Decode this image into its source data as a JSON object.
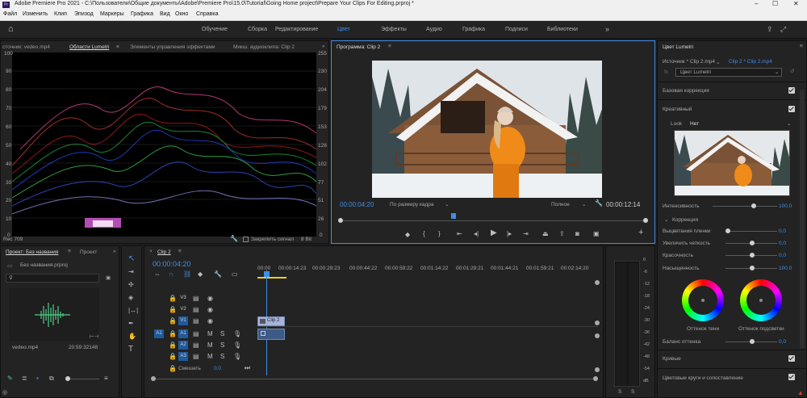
{
  "titlebar": {
    "title": "Adobe Premiere Pro 2021 - C:\\Пользователи\\Общие документы\\Adobe\\Premiere Pro\\15.0\\Tutorial\\Going Home project\\Prepare Your Clips For Editing.prproj *"
  },
  "menu": [
    "Файл",
    "Изменить",
    "Клип",
    "Эпизод",
    "Маркеры",
    "Графика",
    "Вид",
    "Окно",
    "Справка"
  ],
  "workspaces": [
    "Обучение",
    "Сборка",
    "Редактирование",
    "Цвет",
    "Эффекты",
    "Аудио",
    "Графика",
    "Подписи",
    "Библиотеки"
  ],
  "active_workspace": "Цвет",
  "source_panel": {
    "tabs": [
      "сточник: vedeo.mp4",
      "Области Lumetri",
      "Элементы управления эффектами",
      "Микш. аудиоклипа: Clip 2"
    ],
    "left_scale": [
      "100",
      "90",
      "80",
      "70",
      "60",
      "50",
      "40",
      "30",
      "20",
      "10",
      "0"
    ],
    "right_scale": [
      "255",
      "230",
      "204",
      "179",
      "153",
      "128",
      "102",
      "77",
      "51",
      "26",
      "0"
    ],
    "footer_left": "Rec 709",
    "footer_clamp": "Закрепить сигнал",
    "footer_bit": "8 Bit"
  },
  "program_monitor": {
    "title": "Программа: Clip 2",
    "timecode_left": "00:00:04:20",
    "fit": "По размеру кадра",
    "quality": "Полное",
    "timecode_right": "00:00:12:14"
  },
  "project_panel": {
    "tabs": [
      "Проект: Без названия",
      "Проект"
    ],
    "project_file": "Без названия.prproj",
    "clip_name": "vedeo.mp4",
    "clip_duration": "20:59:32148"
  },
  "timeline": {
    "tab": "Clip 2",
    "timecode": "00:00:04:20",
    "ruler": [
      "00:00",
      "00:00:14:23",
      "00:00:29:23",
      "00:00:44:22",
      "00:00:59:22",
      "00:01:14:22",
      "00:01:29:21",
      "00:01:44:21",
      "00:01:59:21",
      "00:02:14:20"
    ],
    "video_tracks": [
      "V3",
      "V2",
      "V1"
    ],
    "audio_tracks": [
      "A1",
      "A2",
      "A3"
    ],
    "source_patch": "A1",
    "clip_label": "Clip 2",
    "mix_label": "Смешать",
    "mix_value": "0,0"
  },
  "meter": {
    "scale": [
      "0",
      "-6",
      "-12",
      "-18",
      "-24",
      "-30",
      "-36",
      "-42",
      "-48",
      "-54",
      "dB"
    ],
    "solo": [
      "S",
      "S"
    ]
  },
  "lumetri": {
    "title": "Цвет Lumetri",
    "source_line": "Источник * Clip 2.mp4",
    "source_link": "Clip 2 * Clip 2.mp4",
    "preset": "Цвет Lumetri",
    "sections": {
      "basic": "Базовая коррекция",
      "creative": "Креативный",
      "curves": "Кривые",
      "wheels": "Цветовые круги и сопоставление"
    },
    "look_label": "Look",
    "look_value": "Нет",
    "intensity_label": "Интенсивность",
    "intensity_value": "100,0",
    "correction_label": "Коррекция",
    "sliders": [
      {
        "label": "Выцветания пленки",
        "value": "0,0"
      },
      {
        "label": "Увеличить четкость",
        "value": "0,0"
      },
      {
        "label": "Красочность",
        "value": "0,0"
      },
      {
        "label": "Насыщенность",
        "value": "100,0"
      }
    ],
    "wheel_shadows": "Оттенок тени",
    "wheel_highlights": "Оттенок подсветки",
    "tint_balance_label": "Баланс оттенка",
    "tint_balance_value": "0,0"
  }
}
